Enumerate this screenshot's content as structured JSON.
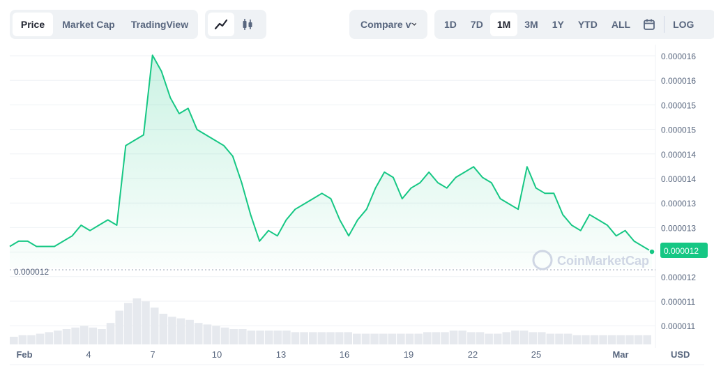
{
  "toolbar": {
    "type_tabs": [
      "Price",
      "Market Cap",
      "TradingView"
    ],
    "active_type": "Price",
    "chart_styles": [
      "line-chart-icon",
      "candlestick-icon"
    ],
    "compare_label": "Compare ѵ",
    "ranges": [
      "1D",
      "7D",
      "1M",
      "3M",
      "1Y",
      "YTD",
      "ALL"
    ],
    "active_range": "1M",
    "calendar_icon": "calendar-icon",
    "log_label": "LOG"
  },
  "colors": {
    "line": "#16c784",
    "current_badge_bg": "#16c784",
    "axis_text": "#58667e",
    "grid": "#eff2f5"
  },
  "chart_data": {
    "type": "line",
    "series": [
      {
        "values": [
          1.23e-05,
          1.24e-05,
          1.24e-05,
          1.23e-05,
          1.23e-05,
          1.23e-05,
          1.24e-05,
          1.25e-05,
          1.27e-05,
          1.26e-05,
          1.27e-05,
          1.28e-05,
          1.27e-05,
          1.42e-05,
          1.43e-05,
          1.44e-05,
          1.59e-05,
          1.56e-05,
          1.51e-05,
          1.48e-05,
          1.49e-05,
          1.45e-05,
          1.44e-05,
          1.43e-05,
          1.42e-05,
          1.4e-05,
          1.35e-05,
          1.29e-05,
          1.24e-05,
          1.26e-05,
          1.25e-05,
          1.28e-05,
          1.3e-05,
          1.31e-05,
          1.32e-05,
          1.33e-05,
          1.32e-05,
          1.28e-05,
          1.25e-05,
          1.28e-05,
          1.3e-05,
          1.34e-05,
          1.37e-05,
          1.36e-05,
          1.32e-05,
          1.34e-05,
          1.35e-05,
          1.37e-05,
          1.35e-05,
          1.34e-05,
          1.36e-05,
          1.37e-05,
          1.38e-05,
          1.36e-05,
          1.35e-05,
          1.32e-05,
          1.31e-05,
          1.3e-05,
          1.38e-05,
          1.34e-05,
          1.33e-05,
          1.33e-05,
          1.29e-05,
          1.27e-05,
          1.26e-05,
          1.29e-05,
          1.28e-05,
          1.27e-05,
          1.25e-05,
          1.26e-05,
          1.24e-05,
          1.23e-05,
          1.22e-05
        ],
        "color": "#16c784"
      }
    ],
    "x_tick_labels": [
      "Feb",
      "4",
      "7",
      "10",
      "13",
      "16",
      "19",
      "22",
      "25",
      "Mar"
    ],
    "y_tick_labels": [
      "0.000016",
      "0.000016",
      "0.000015",
      "0.000015",
      "0.000014",
      "0.000014",
      "0.000013",
      "0.000013",
      "0.000012",
      "0.000012",
      "0.000011",
      "0.000011"
    ],
    "current_value_label": "0.000012",
    "period_low_label": "0.000012",
    "currency_label": "USD",
    "watermark": "CoinMarketCap",
    "volume": [
      5,
      6,
      6,
      7,
      8,
      9,
      10,
      11,
      12,
      11,
      10,
      14,
      22,
      27,
      30,
      28,
      24,
      20,
      18,
      17,
      16,
      14,
      13,
      12,
      11,
      10,
      10,
      9,
      9,
      9,
      9,
      9,
      8,
      8,
      8,
      8,
      8,
      8,
      8,
      7,
      7,
      7,
      7,
      7,
      7,
      7,
      7,
      8,
      8,
      8,
      9,
      9,
      8,
      8,
      7,
      7,
      8,
      9,
      9,
      8,
      8,
      7,
      7,
      7,
      6,
      6,
      6,
      6,
      6,
      6,
      6,
      6,
      6
    ],
    "grid": true
  }
}
